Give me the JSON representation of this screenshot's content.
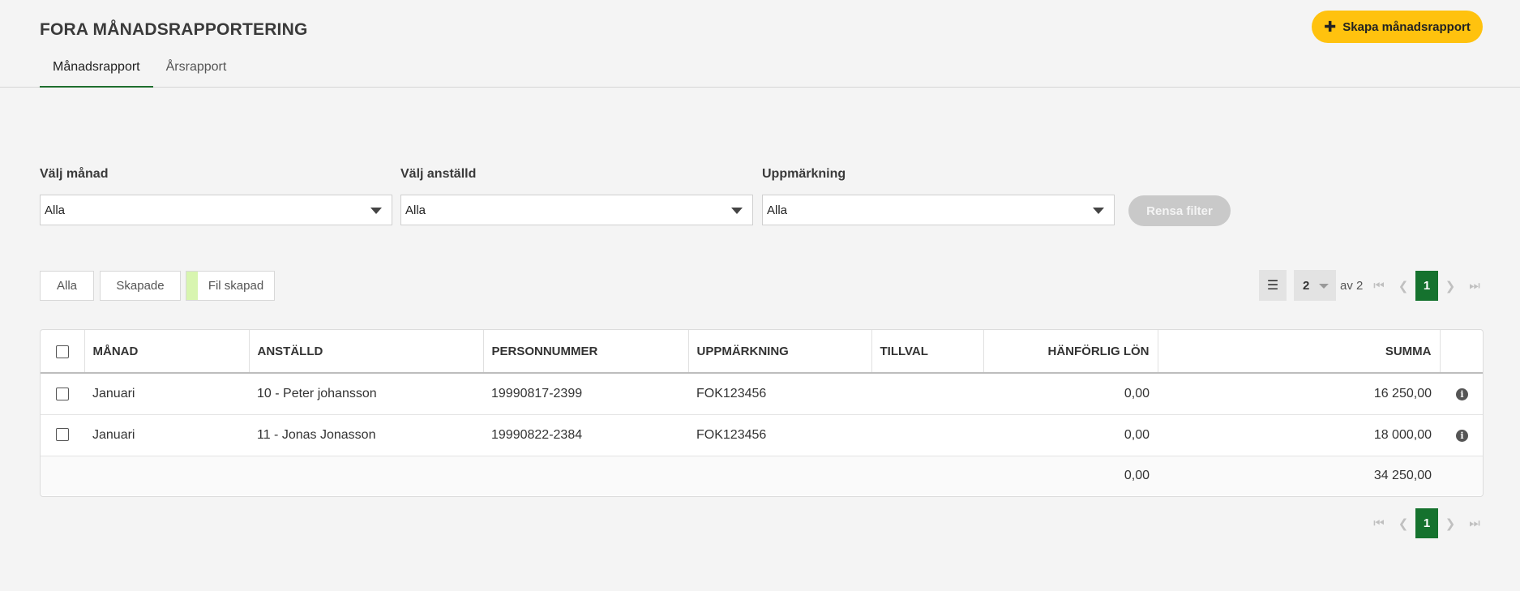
{
  "header": {
    "title": "FORA MÅNADSRAPPORTERING",
    "create_button": "Skapa månadsrapport"
  },
  "tabs": [
    {
      "label": "Månadsrapport",
      "active": true
    },
    {
      "label": "Årsrapport",
      "active": false
    }
  ],
  "filters": {
    "month": {
      "label": "Välj månad",
      "value": "Alla"
    },
    "employee": {
      "label": "Välj anställd",
      "value": "Alla"
    },
    "marking": {
      "label": "Uppmärkning",
      "value": "Alla"
    },
    "clear_button": "Rensa filter"
  },
  "status_filters": {
    "all": "Alla",
    "created": "Skapade",
    "file_created": "Fil skapad",
    "file_created_color": "#d8f5b0"
  },
  "pagination": {
    "page_size": "2",
    "of_label": "av 2",
    "current_page": "1"
  },
  "table": {
    "columns": [
      "MÅNAD",
      "ANSTÄLLD",
      "PERSONNUMMER",
      "UPPMÄRKNING",
      "TILLVAL",
      "HÄNFÖRLIG LÖN",
      "SUMMA"
    ],
    "rows": [
      {
        "month": "Januari",
        "employee": "10 - Peter johansson",
        "pnr": "19990817-2399",
        "marking": "FOK123456",
        "tillval": "",
        "lon": "0,00",
        "summa": "16 250,00"
      },
      {
        "month": "Januari",
        "employee": "11 - Jonas Jonasson",
        "pnr": "19990822-2384",
        "marking": "FOK123456",
        "tillval": "",
        "lon": "0,00",
        "summa": "18 000,00"
      }
    ],
    "totals": {
      "lon": "0,00",
      "summa": "34 250,00"
    }
  },
  "colors": {
    "accent_yellow": "#ffc20e",
    "pager_green": "#15722e",
    "tab_underline": "#1e6e2e"
  }
}
